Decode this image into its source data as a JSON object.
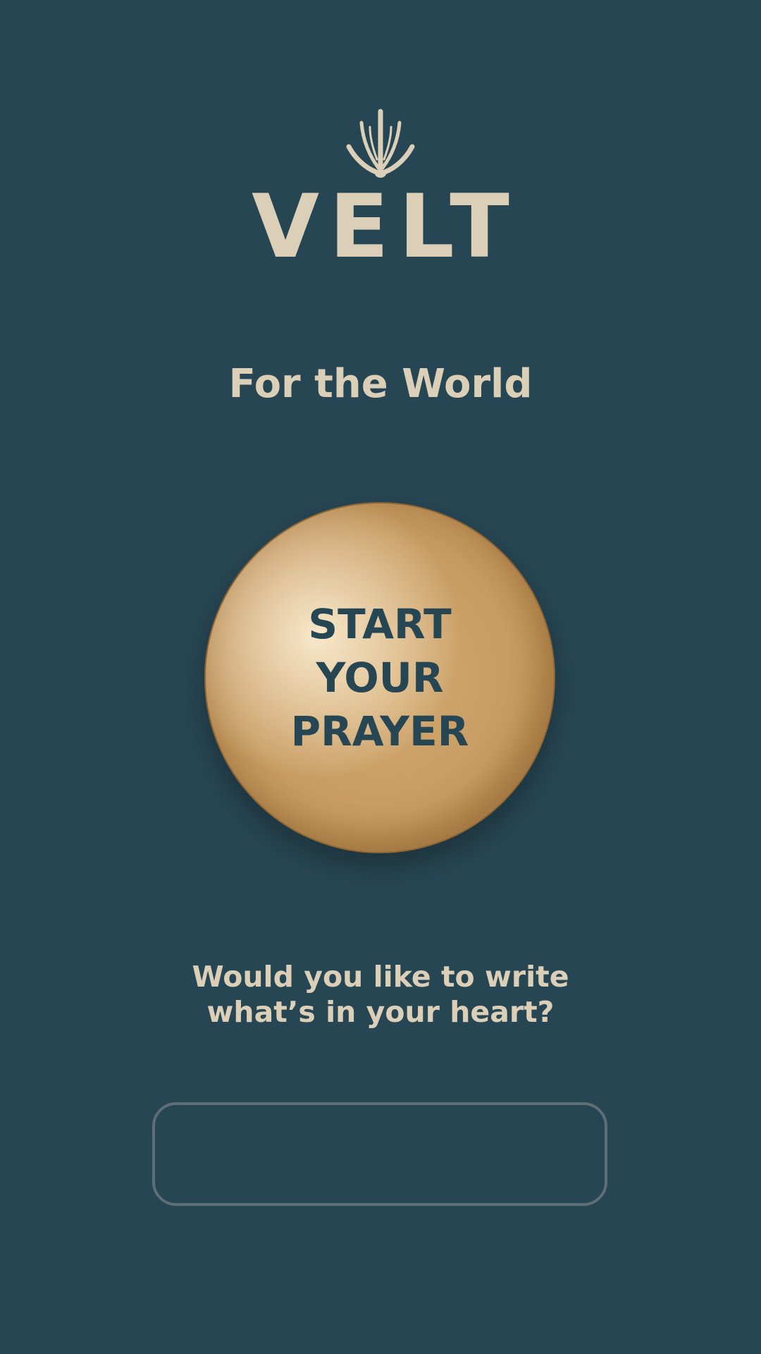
{
  "app": {
    "brand": "VELT",
    "logo_icon": "sprout-icon"
  },
  "header": {
    "subtitle": "For the World"
  },
  "prayer_button": {
    "line1": "START",
    "line2": "YOUR",
    "line3": "PRAYER"
  },
  "prompt": {
    "line1": "Would you like to write",
    "line2": "what’s in your heart?"
  },
  "write_input": {
    "value": "",
    "placeholder": ""
  },
  "colors": {
    "background": "#274653",
    "text_cream": "#DCCFB7",
    "button_gold": "#C79B62",
    "input_border": "#5F6D76"
  }
}
